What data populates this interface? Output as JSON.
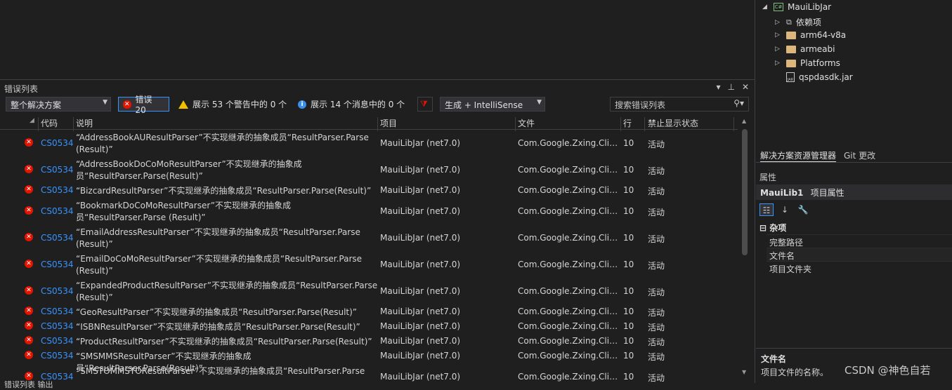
{
  "panel": {
    "title": "错误列表"
  },
  "toolbar": {
    "scope": "整个解决方案",
    "errors": "错误 20",
    "warnings": "展示 53 个警告中的 0 个",
    "messages": "展示 14 个消息中的 0 个",
    "build": "生成 + IntelliSense",
    "search_placeholder": "搜索错误列表"
  },
  "columns": {
    "code": "代码",
    "desc": "说明",
    "project": "项目",
    "file": "文件",
    "line": "行",
    "state": "禁止显示状态"
  },
  "errors": [
    {
      "code": "CS0534",
      "desc": "“AddressBookAUResultParser”不实现继承的抽象成员“ResultParser.Parse (Result)”",
      "project": "MauiLibJar (net7.0)",
      "file": "Com.Google.Zxing.Clien…",
      "line": "10",
      "state": "活动"
    },
    {
      "code": "CS0534",
      "desc": "“AddressBookDoCoMoResultParser”不实现继承的抽象成员“ResultParser.Parse(Result)”",
      "project": "MauiLibJar (net7.0)",
      "file": "Com.Google.Zxing.Clien…",
      "line": "10",
      "state": "活动"
    },
    {
      "code": "CS0534",
      "desc": "“BizcardResultParser”不实现继承的抽象成员“ResultParser.Parse(Result)”",
      "project": "MauiLibJar (net7.0)",
      "file": "Com.Google.Zxing.Clien…",
      "line": "10",
      "state": "活动"
    },
    {
      "code": "CS0534",
      "desc": "“BookmarkDoCoMoResultParser”不实现继承的抽象成员“ResultParser.Parse (Result)”",
      "project": "MauiLibJar (net7.0)",
      "file": "Com.Google.Zxing.Clien…",
      "line": "10",
      "state": "活动"
    },
    {
      "code": "CS0534",
      "desc": "“EmailAddressResultParser”不实现继承的抽象成员“ResultParser.Parse (Result)”",
      "project": "MauiLibJar (net7.0)",
      "file": "Com.Google.Zxing.Clien…",
      "line": "10",
      "state": "活动"
    },
    {
      "code": "CS0534",
      "desc": "“EmailDoCoMoResultParser”不实现继承的抽象成员“ResultParser.Parse (Result)”",
      "project": "MauiLibJar (net7.0)",
      "file": "Com.Google.Zxing.Clien…",
      "line": "10",
      "state": "活动"
    },
    {
      "code": "CS0534",
      "desc": "“ExpandedProductResultParser”不实现继承的抽象成员“ResultParser.Parse (Result)”",
      "project": "MauiLibJar (net7.0)",
      "file": "Com.Google.Zxing.Clien…",
      "line": "10",
      "state": "活动"
    },
    {
      "code": "CS0534",
      "desc": "“GeoResultParser”不实现继承的抽象成员“ResultParser.Parse(Result)”",
      "project": "MauiLibJar (net7.0)",
      "file": "Com.Google.Zxing.Clien…",
      "line": "10",
      "state": "活动"
    },
    {
      "code": "CS0534",
      "desc": "“ISBNResultParser”不实现继承的抽象成员“ResultParser.Parse(Result)”",
      "project": "MauiLibJar (net7.0)",
      "file": "Com.Google.Zxing.Clien…",
      "line": "10",
      "state": "活动"
    },
    {
      "code": "CS0534",
      "desc": "“ProductResultParser”不实现继承的抽象成员“ResultParser.Parse(Result)”",
      "project": "MauiLibJar (net7.0)",
      "file": "Com.Google.Zxing.Clien…",
      "line": "10",
      "state": "活动"
    },
    {
      "code": "CS0534",
      "desc": "“SMSMMSResultParser”不实现继承的抽象成员“ResultParser.Parse(Result)”",
      "project": "MauiLibJar (net7.0)",
      "file": "Com.Google.Zxing.Clien…",
      "line": "10",
      "state": "活动"
    },
    {
      "code": "CS0534",
      "desc": "“SMSTOMMSTOResultParser”不实现继承的抽象成员“ResultParser.Parse",
      "project": "MauiLibJar (net7.0)",
      "file": "Com.Google.Zxing.Clien…",
      "line": "10",
      "state": "活动"
    }
  ],
  "solution_tree": {
    "project": "MauiLibJar",
    "items": [
      "依赖项",
      "arm64-v8a",
      "armeabi",
      "Platforms",
      "qspdasdk.jar"
    ]
  },
  "right_tabs": [
    "解决方案资源管理器",
    "Git 更改"
  ],
  "properties": {
    "title": "属性",
    "subject": "MauiLib1",
    "subject_suffix": "项目属性",
    "category": "杂项",
    "rows": [
      "完整路径",
      "文件名",
      "项目文件夹"
    ],
    "desc_title": "文件名",
    "desc_body": "项目文件的名称。"
  },
  "bottom_tabs": "错误列表  输出",
  "watermark": "CSDN @神色自若",
  "colors": {
    "error": "#e51400",
    "link": "#3794ff",
    "warning": "#f0c000",
    "info": "#3b8eea"
  }
}
